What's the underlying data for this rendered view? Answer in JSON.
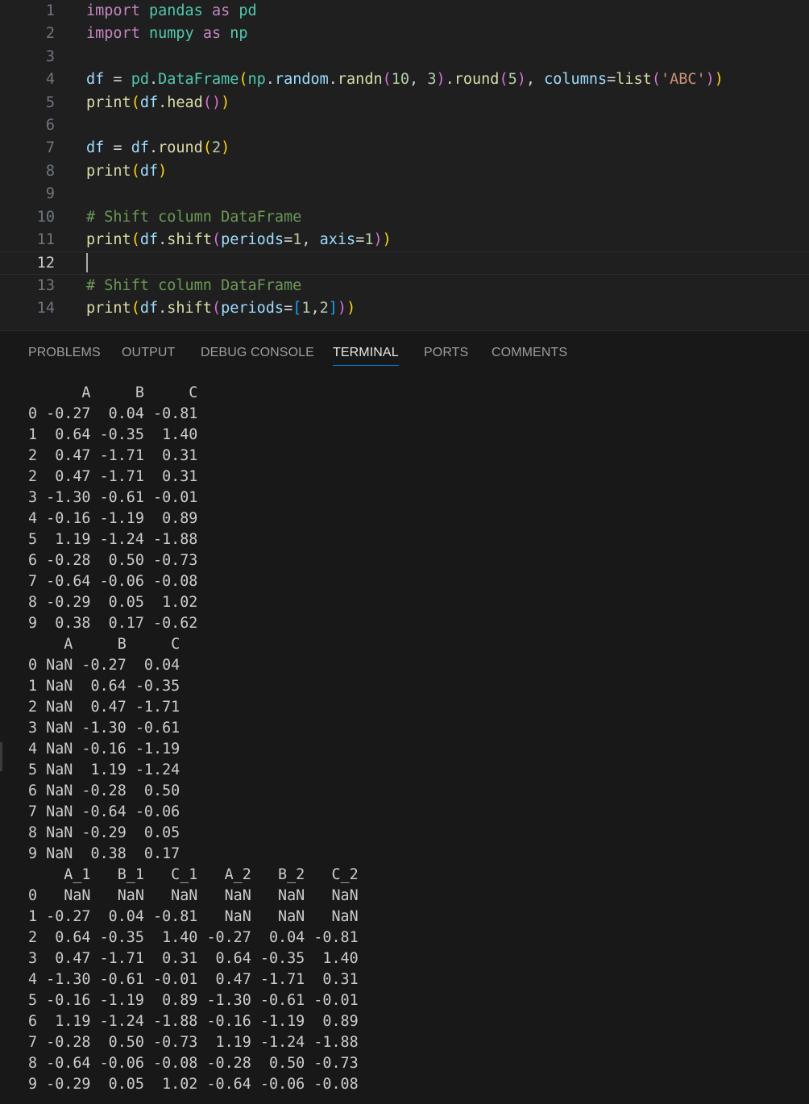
{
  "editor": {
    "lines": [
      {
        "n": "1",
        "tokens": [
          [
            "kw",
            "import"
          ],
          [
            "op",
            " "
          ],
          [
            "nm",
            "pandas"
          ],
          [
            "op",
            " "
          ],
          [
            "kw",
            "as"
          ],
          [
            "op",
            " "
          ],
          [
            "nm",
            "pd"
          ]
        ]
      },
      {
        "n": "2",
        "tokens": [
          [
            "kw",
            "import"
          ],
          [
            "op",
            " "
          ],
          [
            "nm",
            "numpy"
          ],
          [
            "op",
            " "
          ],
          [
            "kw",
            "as"
          ],
          [
            "op",
            " "
          ],
          [
            "nm",
            "np"
          ]
        ]
      },
      {
        "n": "3",
        "tokens": []
      },
      {
        "n": "4",
        "tokens": [
          [
            "vr",
            "df"
          ],
          [
            "op",
            " = "
          ],
          [
            "nm",
            "pd"
          ],
          [
            "op",
            "."
          ],
          [
            "nm",
            "DataFrame"
          ],
          [
            "p1",
            "("
          ],
          [
            "nm",
            "np"
          ],
          [
            "op",
            "."
          ],
          [
            "vr",
            "random"
          ],
          [
            "op",
            "."
          ],
          [
            "fn",
            "randn"
          ],
          [
            "p2",
            "("
          ],
          [
            "nu",
            "10"
          ],
          [
            "op",
            ", "
          ],
          [
            "nu",
            "3"
          ],
          [
            "p2",
            ")"
          ],
          [
            "op",
            "."
          ],
          [
            "fn",
            "round"
          ],
          [
            "p2",
            "("
          ],
          [
            "nu",
            "5"
          ],
          [
            "p2",
            ")"
          ],
          [
            "op",
            ", "
          ],
          [
            "vr",
            "columns"
          ],
          [
            "op",
            "="
          ],
          [
            "fn",
            "list"
          ],
          [
            "p2",
            "("
          ],
          [
            "st",
            "'ABC'"
          ],
          [
            "p2",
            ")"
          ],
          [
            "p1",
            ")"
          ]
        ]
      },
      {
        "n": "5",
        "tokens": [
          [
            "fn",
            "print"
          ],
          [
            "p1",
            "("
          ],
          [
            "vr",
            "df"
          ],
          [
            "op",
            "."
          ],
          [
            "fn",
            "head"
          ],
          [
            "p2",
            "()"
          ],
          [
            "p1",
            ")"
          ]
        ]
      },
      {
        "n": "6",
        "tokens": []
      },
      {
        "n": "7",
        "tokens": [
          [
            "vr",
            "df"
          ],
          [
            "op",
            " = "
          ],
          [
            "vr",
            "df"
          ],
          [
            "op",
            "."
          ],
          [
            "fn",
            "round"
          ],
          [
            "p1",
            "("
          ],
          [
            "nu",
            "2"
          ],
          [
            "p1",
            ")"
          ]
        ]
      },
      {
        "n": "8",
        "tokens": [
          [
            "fn",
            "print"
          ],
          [
            "p1",
            "("
          ],
          [
            "vr",
            "df"
          ],
          [
            "p1",
            ")"
          ]
        ]
      },
      {
        "n": "9",
        "tokens": []
      },
      {
        "n": "10",
        "tokens": [
          [
            "cm",
            "# Shift column DataFrame"
          ]
        ]
      },
      {
        "n": "11",
        "tokens": [
          [
            "fn",
            "print"
          ],
          [
            "p1",
            "("
          ],
          [
            "vr",
            "df"
          ],
          [
            "op",
            "."
          ],
          [
            "fn",
            "shift"
          ],
          [
            "p2",
            "("
          ],
          [
            "vr",
            "periods"
          ],
          [
            "op",
            "="
          ],
          [
            "nu",
            "1"
          ],
          [
            "op",
            ", "
          ],
          [
            "vr",
            "axis"
          ],
          [
            "op",
            "="
          ],
          [
            "nu",
            "1"
          ],
          [
            "p2",
            ")"
          ],
          [
            "p1",
            ")"
          ]
        ]
      },
      {
        "n": "12",
        "tokens": [],
        "active": true
      },
      {
        "n": "13",
        "tokens": [
          [
            "cm",
            "# Shift column DataFrame"
          ]
        ]
      },
      {
        "n": "14",
        "tokens": [
          [
            "fn",
            "print"
          ],
          [
            "p1",
            "("
          ],
          [
            "vr",
            "df"
          ],
          [
            "op",
            "."
          ],
          [
            "fn",
            "shift"
          ],
          [
            "p2",
            "("
          ],
          [
            "vr",
            "periods"
          ],
          [
            "op",
            "="
          ],
          [
            "p3",
            "["
          ],
          [
            "nu",
            "1"
          ],
          [
            "op",
            ","
          ],
          [
            "nu",
            "2"
          ],
          [
            "p3",
            "]"
          ],
          [
            "p2",
            ")"
          ],
          [
            "p1",
            ")"
          ]
        ]
      }
    ]
  },
  "panel": {
    "tabs": [
      {
        "label": "PROBLEMS",
        "active": false
      },
      {
        "label": "OUTPUT",
        "active": false
      },
      {
        "label": "DEBUG CONSOLE",
        "active": false
      },
      {
        "label": "TERMINAL",
        "active": true
      },
      {
        "label": "PORTS",
        "active": false
      },
      {
        "label": "COMMENTS",
        "active": false
      }
    ]
  },
  "terminal": {
    "lines": [
      "      A     B     C",
      "0 -0.27  0.04 -0.81",
      "1  0.64 -0.35  1.40",
      "2  0.47 -1.71  0.31",
      "2  0.47 -1.71  0.31",
      "3 -1.30 -0.61 -0.01",
      "4 -0.16 -1.19  0.89",
      "5  1.19 -1.24 -1.88",
      "6 -0.28  0.50 -0.73",
      "7 -0.64 -0.06 -0.08",
      "8 -0.29  0.05  1.02",
      "9  0.38  0.17 -0.62",
      "    A     B     C",
      "0 NaN -0.27  0.04",
      "1 NaN  0.64 -0.35",
      "2 NaN  0.47 -1.71",
      "3 NaN -1.30 -0.61",
      "4 NaN -0.16 -1.19",
      "5 NaN  1.19 -1.24",
      "6 NaN -0.28  0.50",
      "7 NaN -0.64 -0.06",
      "8 NaN -0.29  0.05",
      "9 NaN  0.38  0.17",
      "    A_1   B_1   C_1   A_2   B_2   C_2",
      "0   NaN   NaN   NaN   NaN   NaN   NaN",
      "1 -0.27  0.04 -0.81   NaN   NaN   NaN",
      "2  0.64 -0.35  1.40 -0.27  0.04 -0.81",
      "3  0.47 -1.71  0.31  0.64 -0.35  1.40",
      "4 -1.30 -0.61 -0.01  0.47 -1.71  0.31",
      "5 -0.16 -1.19  0.89 -1.30 -0.61 -0.01",
      "6  1.19 -1.24 -1.88 -0.16 -1.19  0.89",
      "7 -0.28  0.50 -0.73  1.19 -1.24 -1.88",
      "8 -0.64 -0.06 -0.08 -0.28  0.50 -0.73",
      "9 -0.29  0.05  1.02 -0.64 -0.06 -0.08"
    ]
  }
}
